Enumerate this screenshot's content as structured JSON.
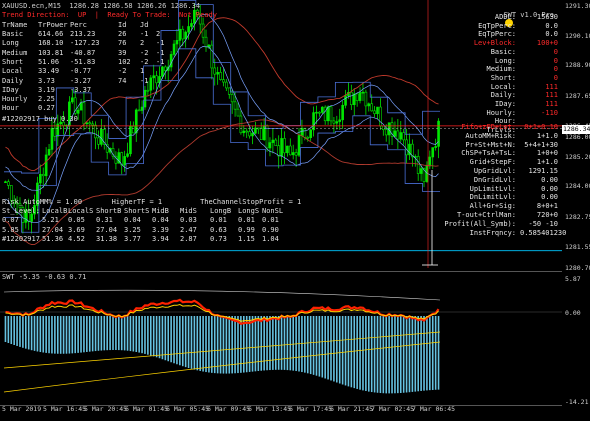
{
  "window": {
    "symbol_line": "XAUUSD.ecn,M15  1286.28 1286.58 1286.26 1286.34",
    "trend_line": "Trend Direction:  UP  |  Ready To Trade:  Not Ready",
    "osc_title": "SWT -5.35 -0.63 0.71",
    "indicator_badge": "SWT v1.0 Pro"
  },
  "left_table": {
    "header": [
      "TrName",
      "TrPower",
      "Perc",
      "Id",
      "Jd"
    ],
    "rows": [
      [
        "Basic",
        "614.66",
        "213.23",
        "26",
        "-1",
        "2"
      ],
      [
        "Long",
        "168.10",
        "-127.23",
        "76",
        "2",
        "-1"
      ],
      [
        "Medium",
        "103.81",
        "-40.87",
        "39",
        "-2",
        "-1"
      ],
      [
        "Short",
        "51.06",
        "-51.83",
        "102",
        "-2",
        "-1"
      ],
      [
        "Local",
        "33.49",
        "-0.77",
        "-2",
        "1",
        ""
      ],
      [
        "Daily",
        "3.73",
        "-3.27",
        "74",
        "-1",
        ""
      ],
      [
        "IDay",
        "3.19",
        "-3.37",
        "",
        "",
        ""
      ],
      [
        "Hourly",
        "2.25",
        "",
        "",
        "",
        ""
      ],
      [
        "Hour",
        "0.27",
        "",
        "",
        "",
        ""
      ]
    ],
    "sell_line": "#12202917 buy 0.30"
  },
  "bottom_table": {
    "line1": "Risk_AutoMM% = 1.00       HigherTF = 1         TheChannelStopProfit = 1",
    "header": [
      "St_Level:",
      "LocalB",
      "LocalS",
      "ShortB",
      "ShortS",
      "MidB",
      "MidS",
      "LongB",
      "LongS",
      "NonSL"
    ],
    "rows": [
      [
        "0.07",
        "5.21",
        "0.05",
        "0.31",
        "0.04",
        "0.04",
        "0.03",
        "0.01",
        "0.01",
        "0.01"
      ],
      [
        "5.85",
        "27.04",
        "3.69",
        "27.04",
        "3.25",
        "3.39",
        "2.47",
        "0.63",
        "0.99",
        "0.90"
      ],
      [
        "#12202917",
        "51.36",
        "4.52",
        "31.38",
        "3.77",
        "3.94",
        "2.87",
        "0.73",
        "1.15",
        "1.04"
      ]
    ]
  },
  "right_panel": {
    "rows": [
      {
        "label": "ADDL:",
        "value": "15630",
        "cls": ""
      },
      {
        "label": "EqTpPerc:",
        "value": "0.0",
        "cls": ""
      },
      {
        "label": "EqTpPerc:",
        "value": "0.0",
        "cls": ""
      },
      {
        "label": "Lev+Block:",
        "value": "100+0",
        "cls": "red"
      },
      {
        "label": "Basic:",
        "value": "0",
        "cls": "redv"
      },
      {
        "label": "Long:",
        "value": "0",
        "cls": "redv"
      },
      {
        "label": "Medium:",
        "value": "0",
        "cls": "redv"
      },
      {
        "label": "Short:",
        "value": "0",
        "cls": "redv"
      },
      {
        "label": "Local:",
        "value": "111",
        "cls": "redv"
      },
      {
        "label": "Daily:",
        "value": "111",
        "cls": "redv"
      },
      {
        "label": "IDay:",
        "value": "111",
        "cls": "redv"
      },
      {
        "label": "Hourly:",
        "value": "-110",
        "cls": "redv"
      },
      {
        "label": "Hour:",
        "value": "",
        "cls": ""
      },
      {
        "label": "TrLvls:",
        "value": "",
        "cls": ""
      }
    ],
    "lower_rows": [
      {
        "label": "Fifo+zFD+Lot:",
        "value": "0+1+0.10"
      },
      {
        "label": "AutoMM+Risk:",
        "value": "1+1.0"
      },
      {
        "label": "Pr+St+Mst+N:",
        "value": "5+4+1+30"
      },
      {
        "label": "ChSP+TsA+TsL:",
        "value": "1+0+0"
      },
      {
        "label": "Grid+StepF:",
        "value": "1+1.0"
      },
      {
        "label": "UpGridLvl:",
        "value": "1291.15"
      },
      {
        "label": "DnGridLvl:",
        "value": "0.00"
      },
      {
        "label": "UpLimitLvl:",
        "value": "0.00"
      },
      {
        "label": "DnLimitLvl:",
        "value": "0.00"
      },
      {
        "label": "All+Gr+Sig:",
        "value": "8+0+1"
      },
      {
        "label": "T-out+CtrlMan:",
        "value": "720+0"
      },
      {
        "label": "Profit(All_Symb):",
        "value": "-50  -10"
      },
      {
        "label": "InstFrqncy:",
        "value": "0.585401230"
      }
    ]
  },
  "price_axis": {
    "labels": [
      "1291.30",
      "1290.10",
      "1288.90",
      "1287.65",
      "1286.45",
      "1286.00",
      "1285.20",
      "1284.00",
      "1282.75",
      "1281.55",
      "1280.70"
    ],
    "current": "1286.34",
    "osc_labels": [
      "5.87",
      "0.00",
      "-14.21"
    ]
  },
  "x_axis": {
    "labels": [
      "5 Mar 2019",
      "5 Mar 16:45",
      "5 Mar 20:45",
      "6 Mar 01:45",
      "6 Mar 05:45",
      "6 Mar 09:45",
      "6 Mar 13:45",
      "6 Mar 17:45",
      "6 Mar 21:45",
      "7 Mar 02:45",
      "7 Mar 06:45"
    ]
  },
  "colors": {
    "candle_up": "#00e600",
    "bg": "#000000",
    "hist": "#66c2e0",
    "osc_red": "#ff2200",
    "osc_yellow": "#ffd400",
    "level_red": "#ff2222",
    "channel_blue": "#4a6fd6"
  }
}
